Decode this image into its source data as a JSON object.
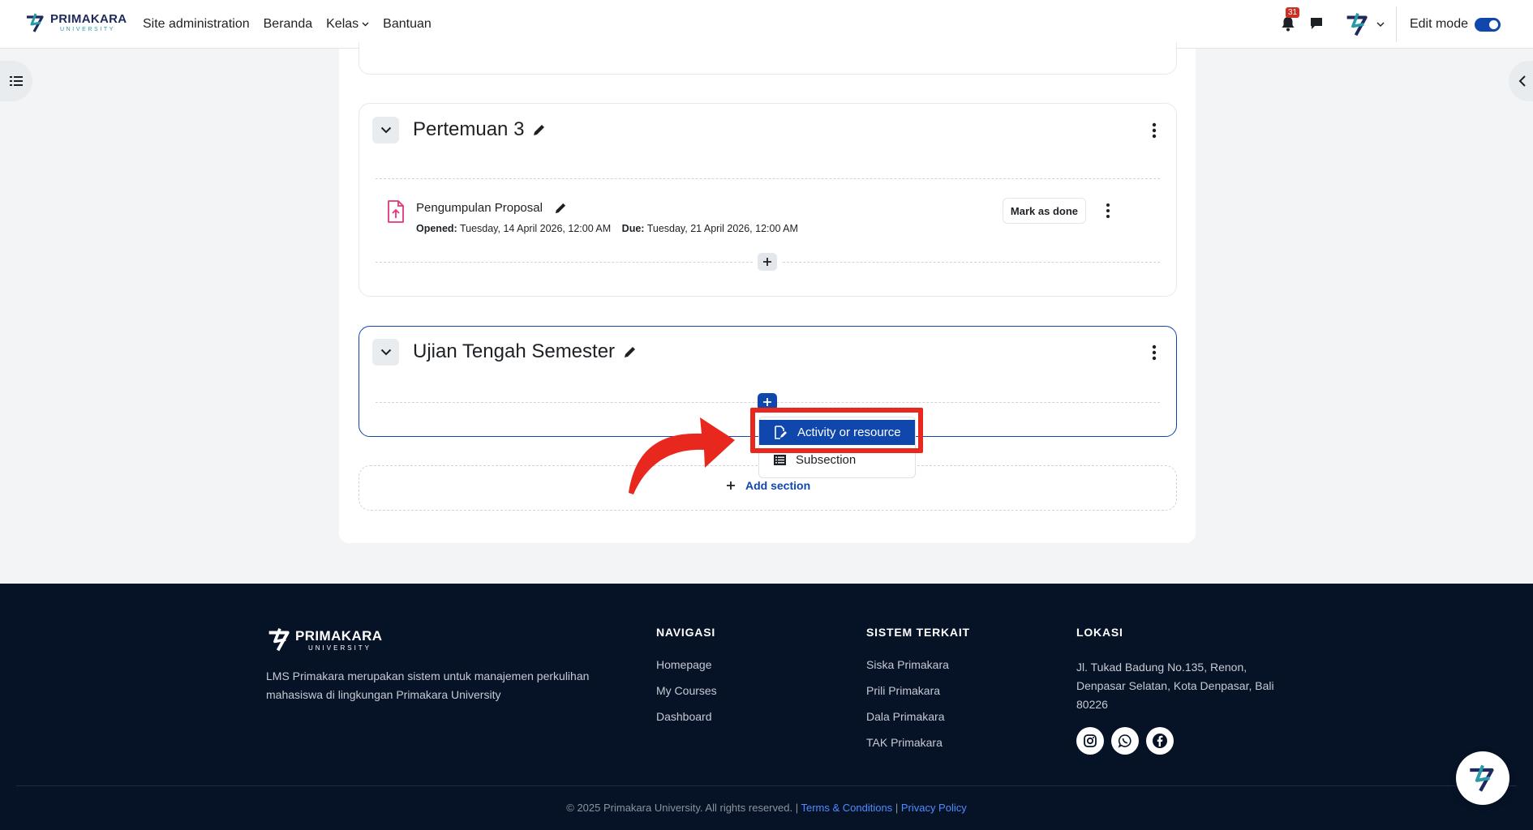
{
  "brand": {
    "name": "PRIMAKARA",
    "subtitle": "UNIVERSITY"
  },
  "nav": {
    "links": [
      "Site administration",
      "Beranda",
      "Kelas",
      "Bantuan"
    ],
    "notification_count": "31",
    "edit_mode_label": "Edit mode",
    "edit_mode_on": true
  },
  "sections": [
    {
      "title": "Pertemuan 3",
      "activities": [
        {
          "name": "Pengumpulan Proposal",
          "opened_label": "Opened:",
          "opened_value": "Tuesday, 14 April 2026, 12:00 AM",
          "due_label": "Due:",
          "due_value": "Tuesday, 21 April 2026, 12:00 AM",
          "mark_done_label": "Mark as done"
        }
      ]
    },
    {
      "title": "Ujian Tengah Semester",
      "activities": []
    }
  ],
  "add_menu": {
    "items": [
      "Activity or resource",
      "Subsection"
    ],
    "highlighted": "Activity or resource"
  },
  "add_section_label": "Add section",
  "footer": {
    "brand_name": "PRIMAKARA",
    "brand_sub": "UNIVERSITY",
    "description": "LMS Primakara merupakan sistem untuk manajemen perkulihan mahasiswa di lingkungan Primakara University",
    "columns": [
      {
        "heading": "NAVIGASI",
        "links": [
          "Homepage",
          "My Courses",
          "Dashboard"
        ]
      },
      {
        "heading": "SISTEM TERKAIT",
        "links": [
          "Siska Primakara",
          "Prili Primakara",
          "Dala Primakara",
          "TAK Primakara"
        ]
      }
    ],
    "location_heading": "LOKASI",
    "address": "Jl. Tukad Badung No.135, Renon, Denpasar Selatan, Kota Denpasar, Bali 80226",
    "social": [
      "instagram-icon",
      "whatsapp-icon",
      "facebook-icon"
    ],
    "copyright": "© 2025 Primakara University. All rights reserved. |",
    "terms_label": "Terms & Conditions",
    "separator": "|",
    "privacy_label": "Privacy Policy"
  },
  "colors": {
    "primary": "#0f47ad",
    "highlight": "#e8281f",
    "footer_bg": "#061327",
    "badge": "#ca3120"
  }
}
